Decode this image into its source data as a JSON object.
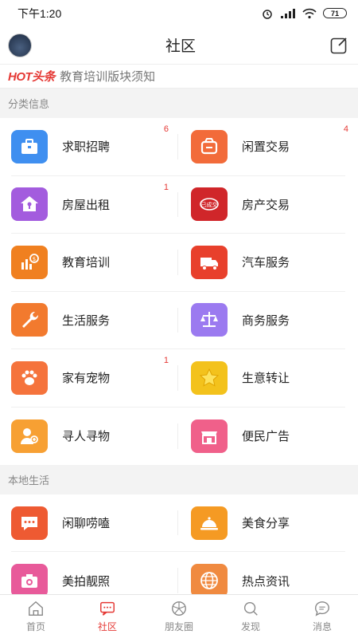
{
  "status": {
    "time": "下午1:20",
    "signal": "..ıl",
    "wifi": "wifi",
    "battery": "71"
  },
  "header": {
    "title": "社区",
    "avatar_icon": "user-avatar",
    "edit_icon": "edit-icon"
  },
  "notice": {
    "brand": "HOT头条",
    "text": "教育培训版块须知"
  },
  "sections": {
    "category_title": "分类信息",
    "local_title": "本地生活"
  },
  "categories": [
    {
      "label": "求职招聘",
      "badge": "6",
      "icon": "briefcase-icon",
      "color": "#3f8ff0"
    },
    {
      "label": "闲置交易",
      "badge": "4",
      "icon": "basket-icon",
      "color": "#f26b3a"
    },
    {
      "label": "房屋出租",
      "badge": "1",
      "icon": "house-key-icon",
      "color": "#a35cde"
    },
    {
      "label": "房产交易",
      "badge": "",
      "icon": "sold-stamp-icon",
      "color": "#d0262a"
    },
    {
      "label": "教育培训",
      "badge": "",
      "icon": "chart-coin-icon",
      "color": "#f08020"
    },
    {
      "label": "汽车服务",
      "badge": "",
      "icon": "truck-icon",
      "color": "#e8402c"
    },
    {
      "label": "生活服务",
      "badge": "",
      "icon": "wrench-icon",
      "color": "#f27a2e"
    },
    {
      "label": "商务服务",
      "badge": "",
      "icon": "scales-icon",
      "color": "#9b7af0"
    },
    {
      "label": "家有宠物",
      "badge": "1",
      "icon": "paw-icon",
      "color": "#f5733c"
    },
    {
      "label": "生意转让",
      "badge": "",
      "icon": "star-icon",
      "color": "#f3c21c"
    },
    {
      "label": "寻人寻物",
      "badge": "",
      "icon": "person-search-icon",
      "color": "#f7a033"
    },
    {
      "label": "便民广告",
      "badge": "",
      "icon": "storefront-icon",
      "color": "#f0608a"
    }
  ],
  "local": [
    {
      "label": "闲聊唠嗑",
      "icon": "chat-bubble-icon",
      "color": "#ee5a32"
    },
    {
      "label": "美食分享",
      "icon": "cloche-icon",
      "color": "#f59a23"
    },
    {
      "label": "美拍靓照",
      "icon": "camera-icon",
      "color": "#e85a9a"
    },
    {
      "label": "热点资讯",
      "icon": "globe-icon",
      "color": "#f08a40"
    }
  ],
  "tabs": [
    {
      "label": "首页",
      "icon": "home-icon",
      "active": false
    },
    {
      "label": "社区",
      "icon": "community-icon",
      "active": true
    },
    {
      "label": "朋友圈",
      "icon": "moments-icon",
      "active": false
    },
    {
      "label": "发现",
      "icon": "discover-icon",
      "active": false
    },
    {
      "label": "消息",
      "icon": "message-icon",
      "active": false
    }
  ],
  "colors": {
    "accent": "#e53935",
    "section_bg": "#f3f3f3"
  }
}
